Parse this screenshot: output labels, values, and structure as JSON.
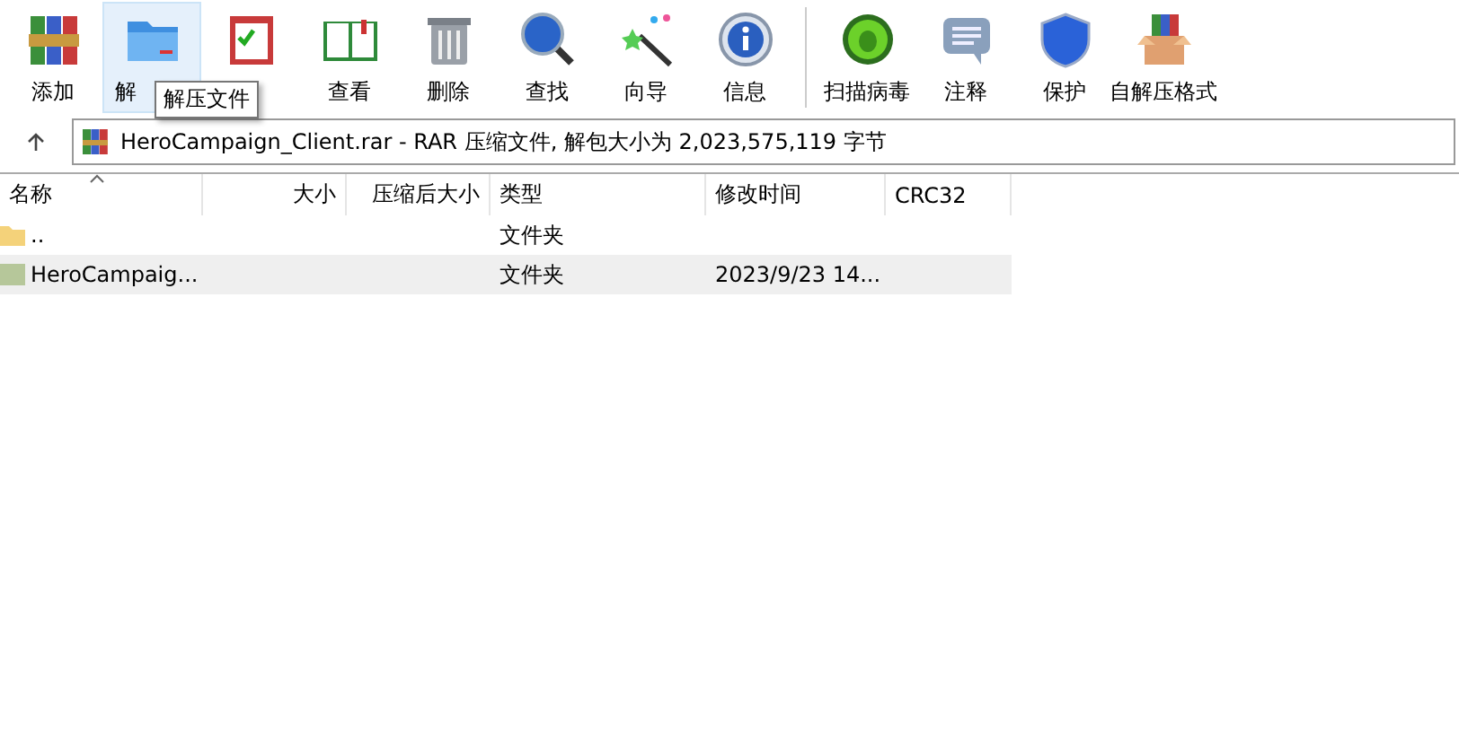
{
  "toolbar": [
    {
      "label": "添加",
      "selected": false
    },
    {
      "label": "解",
      "selected": true
    },
    {
      "selected": false
    },
    {
      "label": "查看",
      "selected": false
    },
    {
      "label": "删除",
      "selected": false
    },
    {
      "label": "查找",
      "selected": false
    },
    {
      "label": "向导",
      "selected": false
    },
    {
      "label": "信息",
      "selected": false
    },
    {
      "label": "扫描病毒",
      "selected": false
    },
    {
      "label": "注释",
      "selected": false
    },
    {
      "label": "保护",
      "selected": false
    },
    {
      "label": "自解压格式",
      "selected": false
    }
  ],
  "tooltip": "解压文件",
  "address": "HeroCampaign_Client.rar - RAR 压缩文件, 解包大小为 2,023,575,119 字节",
  "columns": [
    "名称",
    "大小",
    "压缩后大小",
    "类型",
    "修改时间",
    "CRC32"
  ],
  "rows": [
    {
      "kind": "up",
      "cells": [
        "..",
        "",
        "",
        "文件夹",
        "",
        ""
      ],
      "selected": false
    },
    {
      "kind": "folder",
      "cells": [
        "HeroCampaig...",
        "",
        "",
        "文件夹",
        "2023/9/23 14...",
        ""
      ],
      "selected": true
    }
  ]
}
